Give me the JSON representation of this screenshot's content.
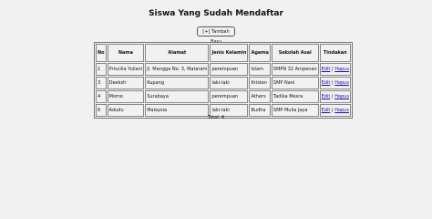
{
  "page": {
    "title": "Siswa Yang Sudah Mendaftar",
    "add_button_label": "[+] Tambah Baru",
    "total_text": "Total: 4"
  },
  "table": {
    "headers": [
      "No",
      "Nama",
      "Alamat",
      "Jenis Kelamin",
      "Agama",
      "Sekolah Asal",
      "Tindakan"
    ],
    "rows": [
      {
        "no": "1",
        "nama": "Priscilia Yuliani",
        "alamat": "Jl. Mangga No. 3, Mataram",
        "jk": "perempuan",
        "agama": "Islam",
        "sekolah": "SMPN 32 Ampenan",
        "edit": "Edit",
        "sep": " | ",
        "hapus": "Hapus"
      },
      {
        "no": "3",
        "nama": "Deeksh",
        "alamat": "Kupang",
        "jk": "laki-laki",
        "agama": "Kristen",
        "sekolah": "SMP Nani",
        "edit": "Edit",
        "sep": " | ",
        "hapus": "Hapus"
      },
      {
        "no": "4",
        "nama": "Momo",
        "alamat": "Surabaya",
        "jk": "perempuan",
        "agama": "Athers",
        "sekolah": "Tadika Mesra",
        "edit": "Edit",
        "sep": " | ",
        "hapus": "Hapus"
      },
      {
        "no": "6",
        "nama": "Adudu",
        "alamat": "Malaysia",
        "jk": "laki-laki",
        "agama": "Budha",
        "sekolah": "SMP Mulia Jaya",
        "edit": "Edit",
        "sep": " | ",
        "hapus": "Hapus"
      }
    ]
  }
}
